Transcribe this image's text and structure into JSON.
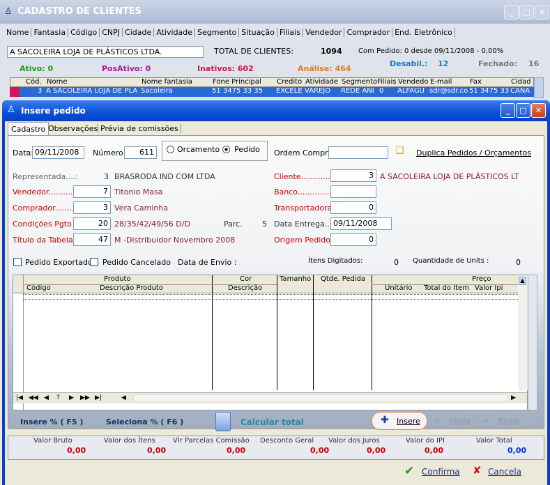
{
  "bg": {
    "title": "CADASTRO DE CLIENTES",
    "tabs": [
      "Nome",
      "Fantasia",
      "Código",
      "CNPJ",
      "Cidade",
      "Atividade",
      "Segmento",
      "Situação",
      "Filiais",
      "Vendedor",
      "Comprador",
      "End. Eletrônico"
    ],
    "search_value": "A SACOLEIRA LOJA DE PLÁSTICOS LTDA.",
    "total_label": "TOTAL DE CLIENTES:",
    "total_value": "1094",
    "com_pedido": "Com Pedido: 0 desde 09/11/2008 -  0,00%",
    "ativo": "Ativo:  0",
    "posativo": "PosAtivo:  0",
    "inativos": "Inativos: 602",
    "analise": "Análise: 464",
    "desabil_label": "Desabil.:",
    "desabil_value": "12",
    "fechado_label": "Fechado:",
    "fechado_value": "16",
    "cols": [
      "Cód.",
      "Nome",
      "Nome fantasia",
      "Fone Principal",
      "Credito",
      "Atividade",
      "Segmento",
      "Filiais",
      "Vendedo",
      "E-mail",
      "Fax",
      "Cidad"
    ],
    "row": [
      "3",
      "A SACOLEIRA LOJA DE PLA",
      "Sacoleira",
      "51 3475 33 35",
      "EXCELE",
      "VAREJO",
      "REDE ANI",
      "0",
      "ALFAGU",
      "sdr@sdr.co",
      "51 3475 33",
      "CANA"
    ]
  },
  "dlg": {
    "title": "Insere pedido",
    "tabs": [
      "Cadastro",
      "Observações",
      "Prévia de comissões"
    ],
    "data_label": "Data:",
    "data_value": "09/11/2008",
    "numero_label": "Número:",
    "numero_value": "611",
    "orcamento": "Orcamento",
    "pedido": "Pedido",
    "ordem_label": "Ordem Compra:",
    "ordem_value": "",
    "duplica": "Duplica Pedidos / Orçamentos",
    "representada_label": "Representada....:",
    "representada_cod": "3",
    "representada_nome": "BRASRODA IND COM LTDA",
    "cliente_label": "Cliente..............:",
    "cliente_cod": "3",
    "cliente_nome": "A SACOLEIRA LOJA DE PLÁSTICOS LT",
    "vendedor_label": "Vendedor...........:",
    "vendedor_cod": "7",
    "vendedor_nome": "Titonio Masa",
    "banco_label": "Banco...............:",
    "banco_value": "",
    "comprador_label": "Comprador.........:",
    "comprador_cod": "3",
    "comprador_nome": "Vera Caminha",
    "transp_label": "Transportadora:",
    "transp_value": "0",
    "cond_label": "Condições Pgto :",
    "cond_cod": "20",
    "cond_desc": "28/35/42/49/56 D/D",
    "parc_label": "Parc.",
    "parc_value": "5",
    "entrega_label": "Data Entrega..:",
    "entrega_value": "09/11/2008",
    "tabela_label": "Título da Tabela:",
    "tabela_cod": "47",
    "tabela_desc": "M -Distribuidor Novembro 2008",
    "origem_label": "Origem Pedido..:",
    "origem_value": "0",
    "exportado": "Pedido Exportado",
    "cancelado": "Pedido Cancelado",
    "envio": "Data de Envio :",
    "itens_label": "Ítens Digitados:",
    "itens_value": "0",
    "units_label": "Quantidade de Units :",
    "units_value": "0",
    "grid": {
      "produto": "Produto",
      "codigo": "Código",
      "descricao": "Descrição Produto",
      "cor": "Cor",
      "cor_desc": "Descrição",
      "tamanho": "Tamanho",
      "qtde": "Qtde. Pedida",
      "preco": "Preço",
      "unitario": "Unitário",
      "total_item": "Total do Item",
      "valor_ipi": "Valor Ipi"
    },
    "nav": [
      "|◀",
      "◀◀",
      "◀",
      "?",
      "▶",
      "▶▶",
      "▶|"
    ],
    "insere_pct": "Insere % ( F5 )",
    "seleciona_pct": "Seleciona % ( F6 )",
    "calcular": "Calcular total",
    "insere_btn": "Insere",
    "altera_btn": "Altera",
    "exclui_btn": "Exclui",
    "totals_labels": [
      "Valor Bruto",
      "Valor dos Ítens",
      "Vlr Parcelas Comissão",
      "Desconto Geral",
      "Valor dos Juros",
      "Valor do IPI",
      "Valor Total"
    ],
    "totals_values": [
      "0,00",
      "0,00",
      "0,00",
      "0,00",
      "0,00",
      "0,00",
      "0,00"
    ],
    "confirma": "Confirma",
    "cancela": "Cancela"
  }
}
